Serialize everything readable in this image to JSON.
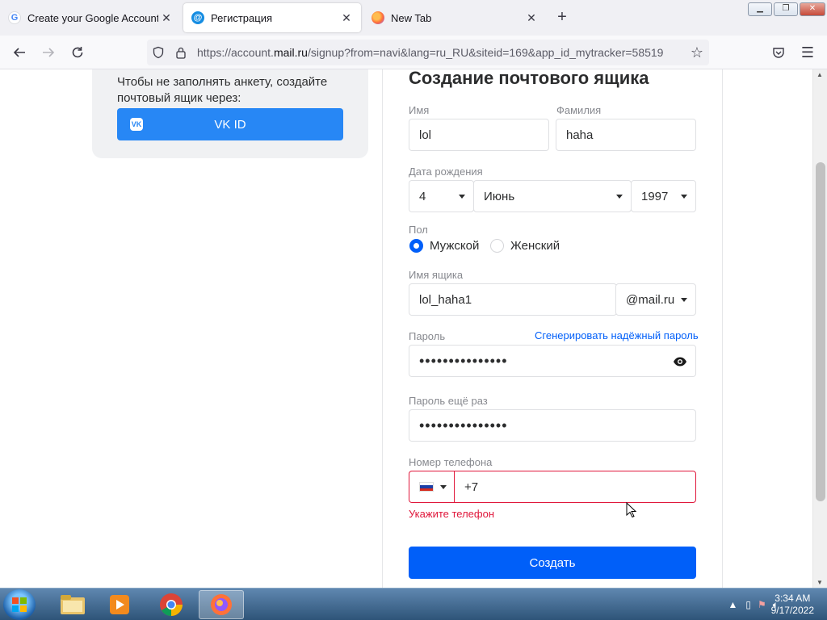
{
  "browser": {
    "tabs": [
      {
        "title": "Create your Google Account",
        "active": false,
        "icon": "google-icon"
      },
      {
        "title": "Регистрация",
        "active": true,
        "icon": "mail-ru-icon"
      },
      {
        "title": "New Tab",
        "active": false,
        "icon": "firefox-icon"
      }
    ],
    "url_prefix": "https://account.",
    "url_domain": "mail.ru",
    "url_suffix": "/signup?from=navi&lang=ru_RU&siteid=169&app_id_mytracker=58519"
  },
  "left_panel": {
    "hint": "Чтобы не заполнять анкету, создайте почтовый ящик через:",
    "vk_button": "VK ID",
    "vk_icon_text": "VK"
  },
  "form": {
    "title": "Создание почтового ящика",
    "first_name_label": "Имя",
    "first_name_value": "lol",
    "last_name_label": "Фамилия",
    "last_name_value": "haha",
    "birth_label": "Дата рождения",
    "birth_day": "4",
    "birth_month": "Июнь",
    "birth_year": "1997",
    "gender_label": "Пол",
    "gender_male": "Мужской",
    "gender_female": "Женский",
    "gender_selected": "male",
    "mailbox_label": "Имя ящика",
    "mailbox_value": "lol_haha1",
    "mailbox_domain": "@mail.ru",
    "password_label": "Пароль",
    "generate_link": "Сгенерировать надёжный пароль",
    "password_mask": "•••••••••••••••",
    "password_repeat_label": "Пароль ещё раз",
    "password_repeat_mask": "•••••••••••••••",
    "phone_label": "Номер телефона",
    "phone_value": "+7",
    "phone_error": "Укажите телефон",
    "submit_label": "Создать"
  },
  "taskbar": {
    "time": "3:34 AM",
    "date": "9/17/2022"
  },
  "colors": {
    "accent": "#005ff9",
    "vk_blue": "#2787f5",
    "error": "#e0173b"
  }
}
